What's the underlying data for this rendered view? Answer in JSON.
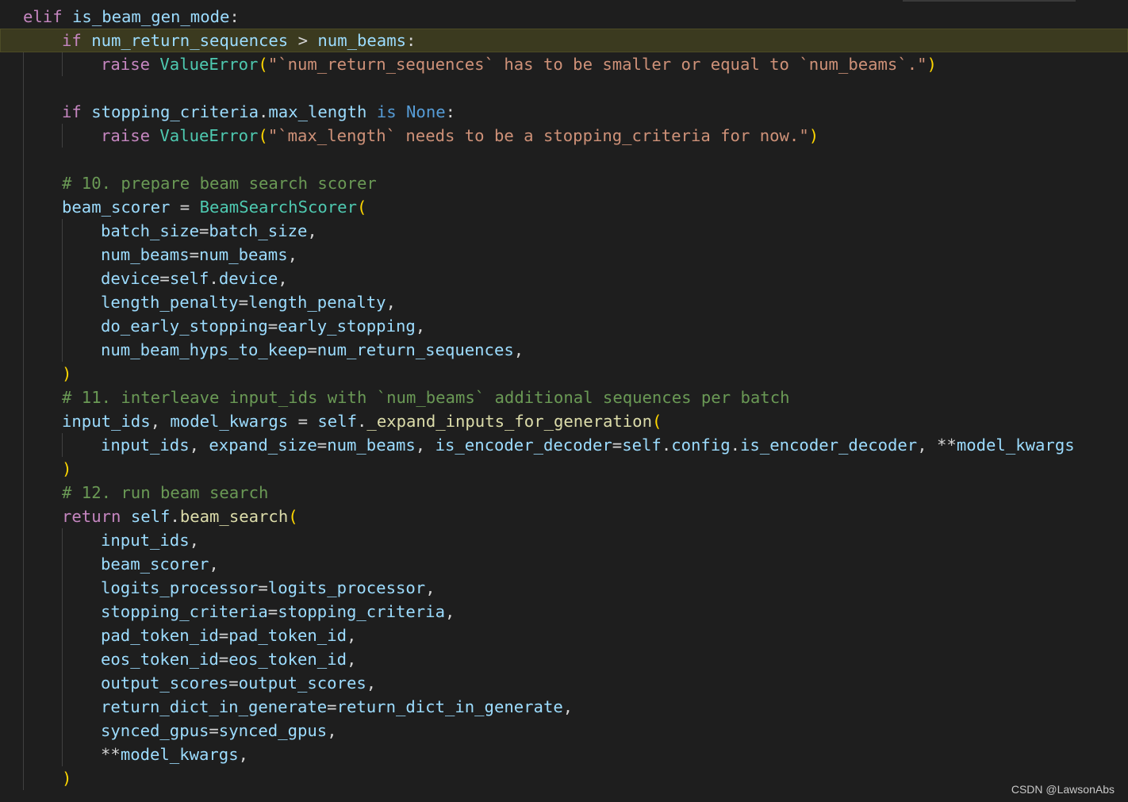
{
  "colors": {
    "background": "#1e1e1e",
    "current_line": "#3b3a1f",
    "keyword_control": "#c586c0",
    "keyword": "#569cd6",
    "variable": "#9cdcfe",
    "class": "#4ec9b0",
    "function": "#dcdcaa",
    "string": "#ce9178",
    "comment": "#6a9955",
    "bracket": "#ffd700",
    "plain": "#d4d4d4"
  },
  "watermark": "CSDN @LawsonAbs",
  "code_lines": [
    {
      "indent": 0,
      "current": false,
      "tokens": [
        {
          "t": "elif",
          "c": "keyword_control"
        },
        {
          "t": " ",
          "c": "plain"
        },
        {
          "t": "is_beam_gen_mode",
          "c": "variable"
        },
        {
          "t": ":",
          "c": "plain"
        }
      ]
    },
    {
      "indent": 1,
      "current": true,
      "tokens": [
        {
          "t": "if",
          "c": "keyword_control"
        },
        {
          "t": " ",
          "c": "plain"
        },
        {
          "t": "num_return_sequences",
          "c": "variable"
        },
        {
          "t": " > ",
          "c": "plain"
        },
        {
          "t": "num_beams",
          "c": "variable"
        },
        {
          "t": ":",
          "c": "plain"
        }
      ]
    },
    {
      "indent": 2,
      "current": false,
      "tokens": [
        {
          "t": "raise",
          "c": "keyword_control"
        },
        {
          "t": " ",
          "c": "plain"
        },
        {
          "t": "ValueError",
          "c": "class"
        },
        {
          "t": "(",
          "c": "bracket"
        },
        {
          "t": "\"`num_return_sequences` has to be smaller or equal to `num_beams`.\"",
          "c": "string"
        },
        {
          "t": ")",
          "c": "bracket"
        }
      ]
    },
    {
      "indent": 0,
      "current": false,
      "tokens": []
    },
    {
      "indent": 1,
      "current": false,
      "tokens": [
        {
          "t": "if",
          "c": "keyword_control"
        },
        {
          "t": " ",
          "c": "plain"
        },
        {
          "t": "stopping_criteria",
          "c": "variable"
        },
        {
          "t": ".",
          "c": "plain"
        },
        {
          "t": "max_length",
          "c": "variable"
        },
        {
          "t": " ",
          "c": "plain"
        },
        {
          "t": "is",
          "c": "keyword"
        },
        {
          "t": " ",
          "c": "plain"
        },
        {
          "t": "None",
          "c": "keyword"
        },
        {
          "t": ":",
          "c": "plain"
        }
      ]
    },
    {
      "indent": 2,
      "current": false,
      "tokens": [
        {
          "t": "raise",
          "c": "keyword_control"
        },
        {
          "t": " ",
          "c": "plain"
        },
        {
          "t": "ValueError",
          "c": "class"
        },
        {
          "t": "(",
          "c": "bracket"
        },
        {
          "t": "\"`max_length` needs to be a stopping_criteria for now.\"",
          "c": "string"
        },
        {
          "t": ")",
          "c": "bracket"
        }
      ]
    },
    {
      "indent": 0,
      "current": false,
      "tokens": []
    },
    {
      "indent": 1,
      "current": false,
      "tokens": [
        {
          "t": "# 10. prepare beam search scorer",
          "c": "comment"
        }
      ]
    },
    {
      "indent": 1,
      "current": false,
      "tokens": [
        {
          "t": "beam_scorer",
          "c": "variable"
        },
        {
          "t": " = ",
          "c": "plain"
        },
        {
          "t": "BeamSearchScorer",
          "c": "class"
        },
        {
          "t": "(",
          "c": "bracket"
        }
      ]
    },
    {
      "indent": 2,
      "current": false,
      "tokens": [
        {
          "t": "batch_size",
          "c": "variable"
        },
        {
          "t": "=",
          "c": "plain"
        },
        {
          "t": "batch_size",
          "c": "variable"
        },
        {
          "t": ",",
          "c": "plain"
        }
      ]
    },
    {
      "indent": 2,
      "current": false,
      "tokens": [
        {
          "t": "num_beams",
          "c": "variable"
        },
        {
          "t": "=",
          "c": "plain"
        },
        {
          "t": "num_beams",
          "c": "variable"
        },
        {
          "t": ",",
          "c": "plain"
        }
      ]
    },
    {
      "indent": 2,
      "current": false,
      "tokens": [
        {
          "t": "device",
          "c": "variable"
        },
        {
          "t": "=",
          "c": "plain"
        },
        {
          "t": "self",
          "c": "variable"
        },
        {
          "t": ".",
          "c": "plain"
        },
        {
          "t": "device",
          "c": "variable"
        },
        {
          "t": ",",
          "c": "plain"
        }
      ]
    },
    {
      "indent": 2,
      "current": false,
      "tokens": [
        {
          "t": "length_penalty",
          "c": "variable"
        },
        {
          "t": "=",
          "c": "plain"
        },
        {
          "t": "length_penalty",
          "c": "variable"
        },
        {
          "t": ",",
          "c": "plain"
        }
      ]
    },
    {
      "indent": 2,
      "current": false,
      "tokens": [
        {
          "t": "do_early_stopping",
          "c": "variable"
        },
        {
          "t": "=",
          "c": "plain"
        },
        {
          "t": "early_stopping",
          "c": "variable"
        },
        {
          "t": ",",
          "c": "plain"
        }
      ]
    },
    {
      "indent": 2,
      "current": false,
      "tokens": [
        {
          "t": "num_beam_hyps_to_keep",
          "c": "variable"
        },
        {
          "t": "=",
          "c": "plain"
        },
        {
          "t": "num_return_sequences",
          "c": "variable"
        },
        {
          "t": ",",
          "c": "plain"
        }
      ]
    },
    {
      "indent": 1,
      "current": false,
      "tokens": [
        {
          "t": ")",
          "c": "bracket"
        }
      ]
    },
    {
      "indent": 1,
      "current": false,
      "tokens": [
        {
          "t": "# 11. interleave input_ids with `num_beams` additional sequences per batch",
          "c": "comment"
        }
      ]
    },
    {
      "indent": 1,
      "current": false,
      "tokens": [
        {
          "t": "input_ids",
          "c": "variable"
        },
        {
          "t": ", ",
          "c": "plain"
        },
        {
          "t": "model_kwargs",
          "c": "variable"
        },
        {
          "t": " = ",
          "c": "plain"
        },
        {
          "t": "self",
          "c": "variable"
        },
        {
          "t": ".",
          "c": "plain"
        },
        {
          "t": "_expand_inputs_for_generation",
          "c": "function"
        },
        {
          "t": "(",
          "c": "bracket"
        }
      ]
    },
    {
      "indent": 2,
      "current": false,
      "tokens": [
        {
          "t": "input_ids",
          "c": "variable"
        },
        {
          "t": ", ",
          "c": "plain"
        },
        {
          "t": "expand_size",
          "c": "variable"
        },
        {
          "t": "=",
          "c": "plain"
        },
        {
          "t": "num_beams",
          "c": "variable"
        },
        {
          "t": ", ",
          "c": "plain"
        },
        {
          "t": "is_encoder_decoder",
          "c": "variable"
        },
        {
          "t": "=",
          "c": "plain"
        },
        {
          "t": "self",
          "c": "variable"
        },
        {
          "t": ".",
          "c": "plain"
        },
        {
          "t": "config",
          "c": "variable"
        },
        {
          "t": ".",
          "c": "plain"
        },
        {
          "t": "is_encoder_decoder",
          "c": "variable"
        },
        {
          "t": ", **",
          "c": "plain"
        },
        {
          "t": "model_kwargs",
          "c": "variable"
        }
      ]
    },
    {
      "indent": 1,
      "current": false,
      "tokens": [
        {
          "t": ")",
          "c": "bracket"
        }
      ]
    },
    {
      "indent": 1,
      "current": false,
      "tokens": [
        {
          "t": "# 12. run beam search",
          "c": "comment"
        }
      ]
    },
    {
      "indent": 1,
      "current": false,
      "tokens": [
        {
          "t": "return",
          "c": "keyword_control"
        },
        {
          "t": " ",
          "c": "plain"
        },
        {
          "t": "self",
          "c": "variable"
        },
        {
          "t": ".",
          "c": "plain"
        },
        {
          "t": "beam_search",
          "c": "function"
        },
        {
          "t": "(",
          "c": "bracket"
        }
      ]
    },
    {
      "indent": 2,
      "current": false,
      "tokens": [
        {
          "t": "input_ids",
          "c": "variable"
        },
        {
          "t": ",",
          "c": "plain"
        }
      ]
    },
    {
      "indent": 2,
      "current": false,
      "tokens": [
        {
          "t": "beam_scorer",
          "c": "variable"
        },
        {
          "t": ",",
          "c": "plain"
        }
      ]
    },
    {
      "indent": 2,
      "current": false,
      "tokens": [
        {
          "t": "logits_processor",
          "c": "variable"
        },
        {
          "t": "=",
          "c": "plain"
        },
        {
          "t": "logits_processor",
          "c": "variable"
        },
        {
          "t": ",",
          "c": "plain"
        }
      ]
    },
    {
      "indent": 2,
      "current": false,
      "tokens": [
        {
          "t": "stopping_criteria",
          "c": "variable"
        },
        {
          "t": "=",
          "c": "plain"
        },
        {
          "t": "stopping_criteria",
          "c": "variable"
        },
        {
          "t": ",",
          "c": "plain"
        }
      ]
    },
    {
      "indent": 2,
      "current": false,
      "tokens": [
        {
          "t": "pad_token_id",
          "c": "variable"
        },
        {
          "t": "=",
          "c": "plain"
        },
        {
          "t": "pad_token_id",
          "c": "variable"
        },
        {
          "t": ",",
          "c": "plain"
        }
      ]
    },
    {
      "indent": 2,
      "current": false,
      "tokens": [
        {
          "t": "eos_token_id",
          "c": "variable"
        },
        {
          "t": "=",
          "c": "plain"
        },
        {
          "t": "eos_token_id",
          "c": "variable"
        },
        {
          "t": ",",
          "c": "plain"
        }
      ]
    },
    {
      "indent": 2,
      "current": false,
      "tokens": [
        {
          "t": "output_scores",
          "c": "variable"
        },
        {
          "t": "=",
          "c": "plain"
        },
        {
          "t": "output_scores",
          "c": "variable"
        },
        {
          "t": ",",
          "c": "plain"
        }
      ]
    },
    {
      "indent": 2,
      "current": false,
      "tokens": [
        {
          "t": "return_dict_in_generate",
          "c": "variable"
        },
        {
          "t": "=",
          "c": "plain"
        },
        {
          "t": "return_dict_in_generate",
          "c": "variable"
        },
        {
          "t": ",",
          "c": "plain"
        }
      ]
    },
    {
      "indent": 2,
      "current": false,
      "tokens": [
        {
          "t": "synced_gpus",
          "c": "variable"
        },
        {
          "t": "=",
          "c": "plain"
        },
        {
          "t": "synced_gpus",
          "c": "variable"
        },
        {
          "t": ",",
          "c": "plain"
        }
      ]
    },
    {
      "indent": 2,
      "current": false,
      "tokens": [
        {
          "t": "**",
          "c": "plain"
        },
        {
          "t": "model_kwargs",
          "c": "variable"
        },
        {
          "t": ",",
          "c": "plain"
        }
      ]
    },
    {
      "indent": 1,
      "current": false,
      "tokens": [
        {
          "t": ")",
          "c": "bracket"
        }
      ]
    }
  ]
}
